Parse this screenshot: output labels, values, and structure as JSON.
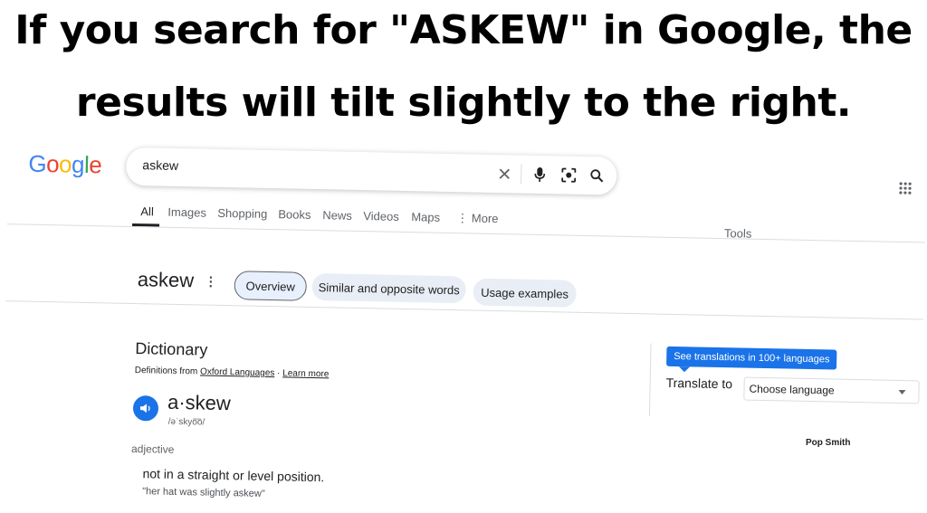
{
  "caption": {
    "line1": "If you search for \"ASKEW\" in Google, the",
    "line2": "results will tilt slightly to the right."
  },
  "header": {
    "logo_letters": [
      "G",
      "o",
      "o",
      "g",
      "l",
      "e"
    ],
    "logo_colors": [
      "#4285f4",
      "#ea4335",
      "#fbbc05",
      "#4285f4",
      "#34a853",
      "#ea4335"
    ],
    "search": {
      "value": "askew"
    },
    "icons": [
      "clear-icon",
      "microphone-icon",
      "lens-icon",
      "search-icon",
      "apps-grid-icon"
    ]
  },
  "tabs": {
    "items": [
      "All",
      "Images",
      "Shopping",
      "Books",
      "News",
      "Videos",
      "Maps",
      "⋮ More"
    ],
    "active": "All",
    "tools": "Tools"
  },
  "overview": {
    "word": "askew",
    "chips": [
      "Overview",
      "Similar and opposite words",
      "Usage examples"
    ]
  },
  "dictionary": {
    "title": "Dictionary",
    "source_prefix": "Definitions from ",
    "source_link": "Oxford Languages",
    "source_sep": " · ",
    "learn_more": "Learn more",
    "headword": "a·skew",
    "phonetic": "/əˈskyo͞o/",
    "part_of_speech": "adjective",
    "definition": "not in a straight or level position.",
    "example": "\"her hat was slightly askew\""
  },
  "translate": {
    "tooltip": "See translations in 100+ languages",
    "label": "Translate to",
    "placeholder": "Choose language"
  },
  "credit": "Pop Smith",
  "colors": {
    "accent": "#1a73e8",
    "chip_bg": "#e9eef6"
  }
}
